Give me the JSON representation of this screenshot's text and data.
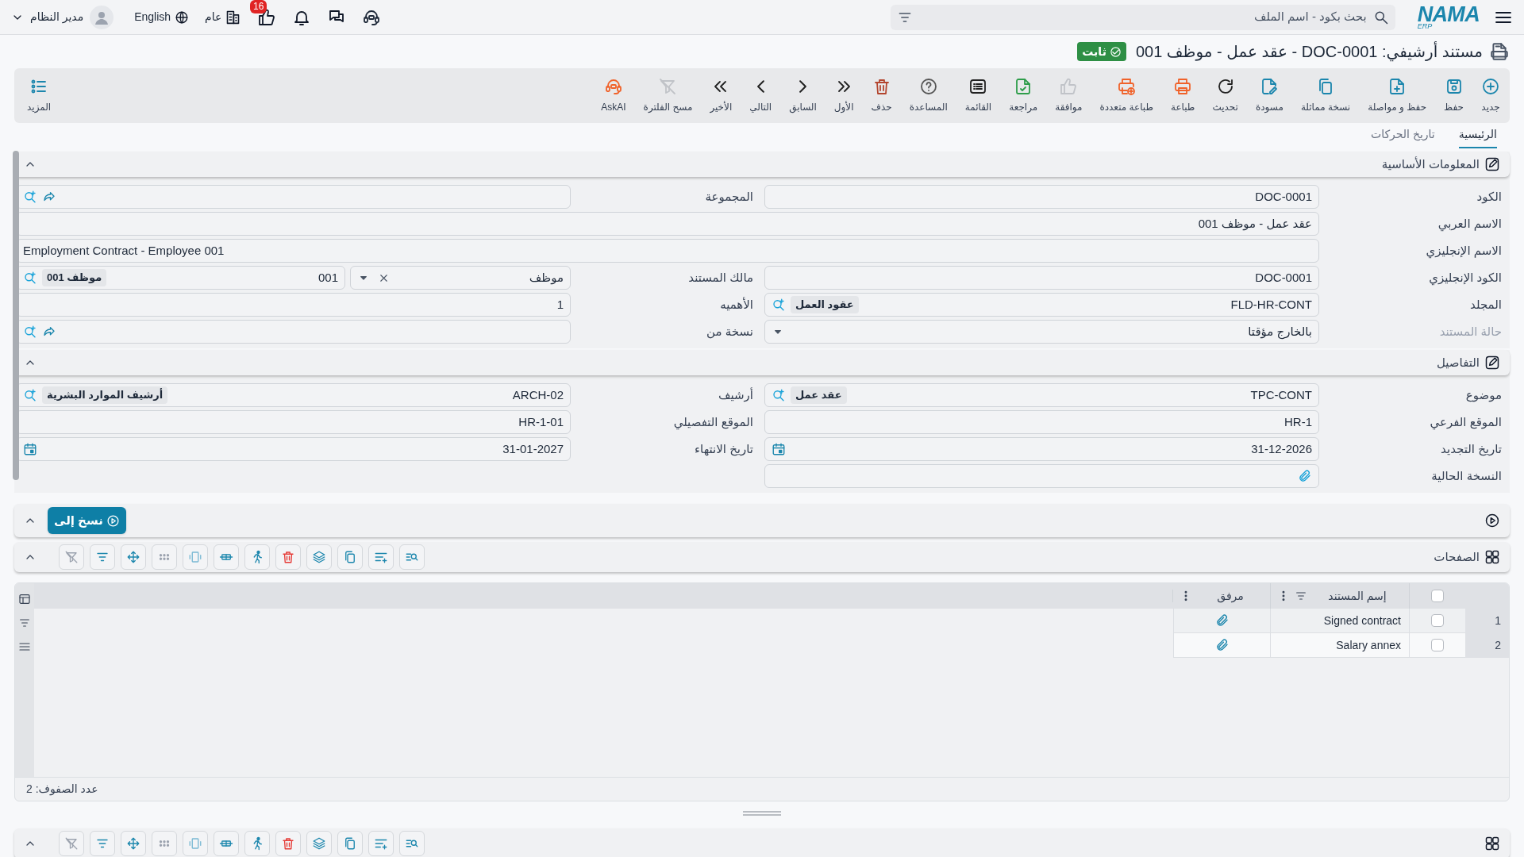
{
  "top_bar": {
    "logo": {
      "name": "NAMA",
      "sub": "ERP"
    },
    "search": {
      "placeholder": "بحث بكود - اسم الملف"
    },
    "notifications": {
      "count": "16"
    },
    "company": "عام",
    "language": "English",
    "user": "مدير النظام"
  },
  "title": {
    "text": "مستند أرشيفي: DOC-0001 - عقد عمل - موظف 001",
    "status": "ثابت"
  },
  "toolbar": [
    {
      "label": "جديد",
      "kind": "new",
      "disabled": false
    },
    {
      "label": "حفظ",
      "kind": "save",
      "disabled": false
    },
    {
      "label": "حفظ و مواصلة",
      "kind": "save_continue",
      "disabled": false
    },
    {
      "label": "نسخة مماثلة",
      "kind": "duplicate",
      "disabled": false
    },
    {
      "label": "مسودة",
      "kind": "draft",
      "disabled": false
    },
    {
      "label": "تحديث",
      "kind": "refresh",
      "disabled": false
    },
    {
      "label": "طباعة",
      "kind": "print",
      "disabled": false
    },
    {
      "label": "طباعة متعددة",
      "kind": "print_multi",
      "disabled": false
    },
    {
      "label": "موافقة",
      "kind": "approve",
      "disabled": true
    },
    {
      "label": "مراجعة",
      "kind": "review",
      "disabled": false
    },
    {
      "label": "القائمة",
      "kind": "list",
      "disabled": false
    },
    {
      "label": "المساعدة",
      "kind": "help",
      "disabled": false
    },
    {
      "label": "حذف",
      "kind": "delete",
      "disabled": false
    },
    {
      "label": "الأول",
      "kind": "first",
      "disabled": false
    },
    {
      "label": "السابق",
      "kind": "previous",
      "disabled": false
    },
    {
      "label": "التالي",
      "kind": "next",
      "disabled": false
    },
    {
      "label": "الأخير",
      "kind": "last",
      "disabled": false
    },
    {
      "label": "مسح الفلترة",
      "kind": "clear_filter",
      "disabled": true
    },
    {
      "label": "AskAI",
      "kind": "ask_ai",
      "disabled": false
    }
  ],
  "more": "المزيد",
  "tabs": [
    {
      "label": "الرئيسية",
      "selected": true
    },
    {
      "label": "تاريخ الحركات",
      "selected": false
    }
  ],
  "sections": [
    {
      "title": "المعلومات الأساسية",
      "rows": [
        [
          {
            "label": "الكود",
            "kind": "text",
            "value": "DOC-0001",
            "disabled": false
          },
          {
            "label": "المجموعة",
            "kind": "link_lookup",
            "disabled": false
          }
        ],
        [
          {
            "label": "الاسم العربي",
            "kind": "wide",
            "value": "عقد عمل - موظف 001",
            "disabled": false
          }
        ],
        [
          {
            "label": "الاسم الإنجليزي",
            "kind": "wide_latin",
            "value": "Employment Contract - Employee 001",
            "disabled": false
          }
        ],
        [
          {
            "label": "الكود الإنجليزي",
            "kind": "text",
            "value": "DOC-0001",
            "disabled": false
          },
          {
            "label": "مالك المستند",
            "kind": "owner",
            "type_value": "موظف",
            "value": "001",
            "chip": "موظف 001",
            "disabled": false
          }
        ],
        [
          {
            "label": "المجلد",
            "kind": "lookup",
            "value": "FLD-HR-CONT",
            "chip": "عقود العمل",
            "disabled": false
          },
          {
            "label": "الأهميه",
            "kind": "text",
            "value": "1",
            "disabled": false
          }
        ],
        [
          {
            "label": "حالة المستند",
            "kind": "select",
            "value": "بالخارج مؤقتا",
            "disabled": true
          },
          {
            "label": "نسخة من",
            "kind": "link_lookup",
            "disabled": false
          }
        ]
      ]
    },
    {
      "title": "التفاصيل",
      "rows": [
        [
          {
            "label": "موضوع",
            "kind": "lookup",
            "value": "TPC-CONT",
            "chip": "عقد عمل",
            "disabled": false
          },
          {
            "label": "أرشيف",
            "kind": "lookup",
            "value": "ARCH-02",
            "chip": "أرشيف الموارد البشرية",
            "disabled": false
          }
        ],
        [
          {
            "label": "الموقع الفرعي",
            "kind": "text",
            "value": "HR-1",
            "disabled": false
          },
          {
            "label": "الموقع التفصيلي",
            "kind": "text",
            "value": "HR-1-01",
            "disabled": false
          }
        ],
        [
          {
            "label": "تاريخ التجديد",
            "kind": "date",
            "value": "31-12-2026",
            "disabled": false
          },
          {
            "label": "تاريخ الانتهاء",
            "kind": "date",
            "value": "31-01-2027",
            "disabled": false
          }
        ],
        [
          {
            "label": "النسخة الحالية",
            "kind": "attachment",
            "disabled": false
          }
        ]
      ]
    }
  ],
  "actions": {
    "copy_to": "نسخ إلى"
  },
  "pages": {
    "title": "الصفحات",
    "all_checked": false,
    "columns": [
      {
        "label": "إسم المستند",
        "filterable": true
      },
      {
        "label": "مرفق",
        "filterable": false
      }
    ],
    "rows": [
      {
        "number": "1",
        "checked": false,
        "name": "Signed contract",
        "attachment": true
      },
      {
        "number": "2",
        "checked": false,
        "name": "Salary annex",
        "attachment": true
      }
    ],
    "footer": "عدد الصفوف: 2"
  }
}
